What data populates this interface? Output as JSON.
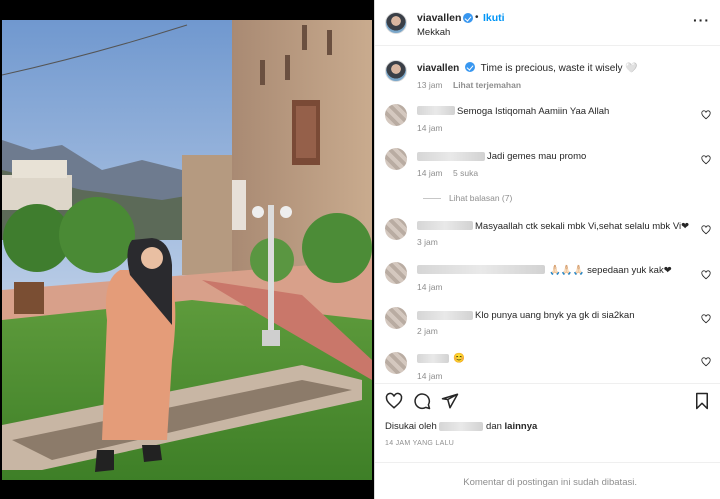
{
  "post": {
    "username": "viavallen",
    "follow_label": "Ikuti",
    "location": "Mekkah",
    "more_icon": "more-horizontal-icon",
    "caption": "Time is precious, waste it wisely 🤍",
    "caption_time": "13 jam",
    "translate_label": "Lihat terjemahan"
  },
  "comments": [
    {
      "text": "Semoga Istiqomah Aamiin Yaa Allah",
      "time": "14 jam",
      "likes": ""
    },
    {
      "text": "Jadi gemes mau promo",
      "time": "14 jam",
      "likes": "5 suka"
    },
    {
      "text": "Masyaallah ctk sekali mbk Vi,sehat selalu mbk Vi❤",
      "time": "3 jam",
      "likes": ""
    },
    {
      "text": "🙏🏻🙏🏻🙏🏻 sepedaan yuk kak❤",
      "time": "14 jam",
      "likes": ""
    },
    {
      "text": "Klo punya uang bnyk ya gk di sia2kan",
      "time": "2 jam",
      "likes": ""
    },
    {
      "text": "😊",
      "time": "14 jam",
      "likes": ""
    }
  ],
  "view_replies": "Lihat balasan (7)",
  "actions": {
    "icons": [
      "heart-icon",
      "comment-icon",
      "share-icon",
      "bookmark-icon"
    ]
  },
  "likes": {
    "prefix": "Disukai oleh",
    "connector": "dan",
    "others": "lainnya"
  },
  "posted_ago": "14 JAM YANG LALU",
  "comments_disabled": "Komentar di postingan ini sudah dibatasi."
}
